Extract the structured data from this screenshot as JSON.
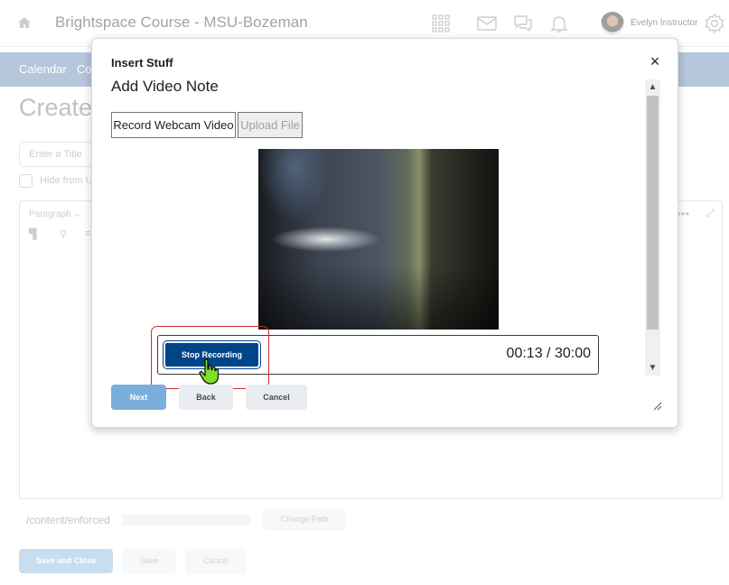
{
  "background": {
    "course_title": "Brightspace Course - MSU-Bozeman",
    "user_name": "Evelyn Instructor",
    "nav": [
      "Calendar",
      "Co"
    ],
    "page_heading": "Create",
    "title_placeholder": "Enter a Title",
    "hide_label": "Hide from U",
    "editor_format": "Paragraph",
    "path_text": "/content/enforced",
    "change_path_label": "Change Path",
    "save_close_label": "Save and Close",
    "save_label": "Save",
    "cancel_label": "Cancel"
  },
  "dialog": {
    "caption": "Insert Stuff",
    "title": "Add Video Note",
    "close_glyph": "×",
    "tabs": {
      "record": "Record Webcam Video",
      "upload": "Upload File"
    },
    "recorder": {
      "stop_label": "Stop Recording",
      "elapsed": "00:13",
      "separator": "/",
      "limit": "30:00"
    },
    "buttons": {
      "next": "Next",
      "back": "Back",
      "cancel": "Cancel"
    }
  },
  "colors": {
    "nav_bar": "#8fa8c8",
    "stop_button": "#004489",
    "next_button": "#7aaedb",
    "highlight": "#cc2b2b"
  },
  "icons": [
    "home-icon",
    "apps-grid-icon",
    "mail-icon",
    "chat-icon",
    "bell-icon",
    "gear-icon",
    "close-icon",
    "scroll-up-icon",
    "scroll-down-icon",
    "resize-handle-icon",
    "hand-pointer-icon"
  ]
}
